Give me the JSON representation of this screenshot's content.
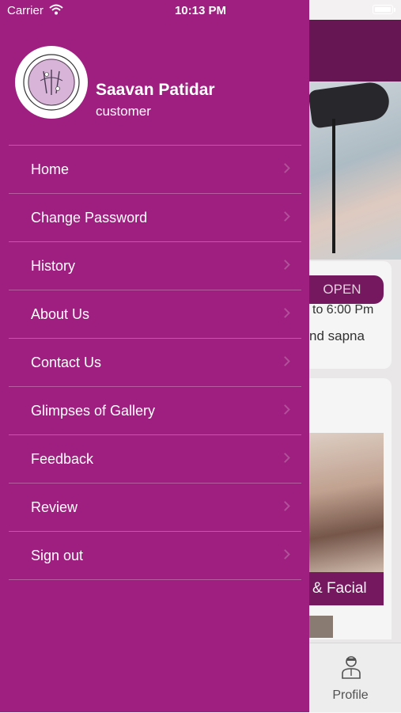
{
  "status_bar": {
    "carrier": "Carrier",
    "time": "10:13 PM"
  },
  "drawer": {
    "user_name": "Saavan Patidar",
    "user_role": "customer",
    "menu": [
      {
        "label": "Home"
      },
      {
        "label": "Change Password"
      },
      {
        "label": "History"
      },
      {
        "label": "About Us"
      },
      {
        "label": "Contact Us"
      },
      {
        "label": "Glimpses of Gallery"
      },
      {
        "label": "Feedback"
      },
      {
        "label": "Review"
      },
      {
        "label": "Sign out"
      }
    ]
  },
  "background": {
    "open_badge": "OPEN",
    "hours_fragment": "to 6:00 Pm",
    "address_fragment": "nd sapna",
    "service_fragment": "& Facial",
    "tab_profile": "Profile"
  },
  "colors": {
    "drawer": "#9e1f7f",
    "accent": "#7a1a63"
  }
}
